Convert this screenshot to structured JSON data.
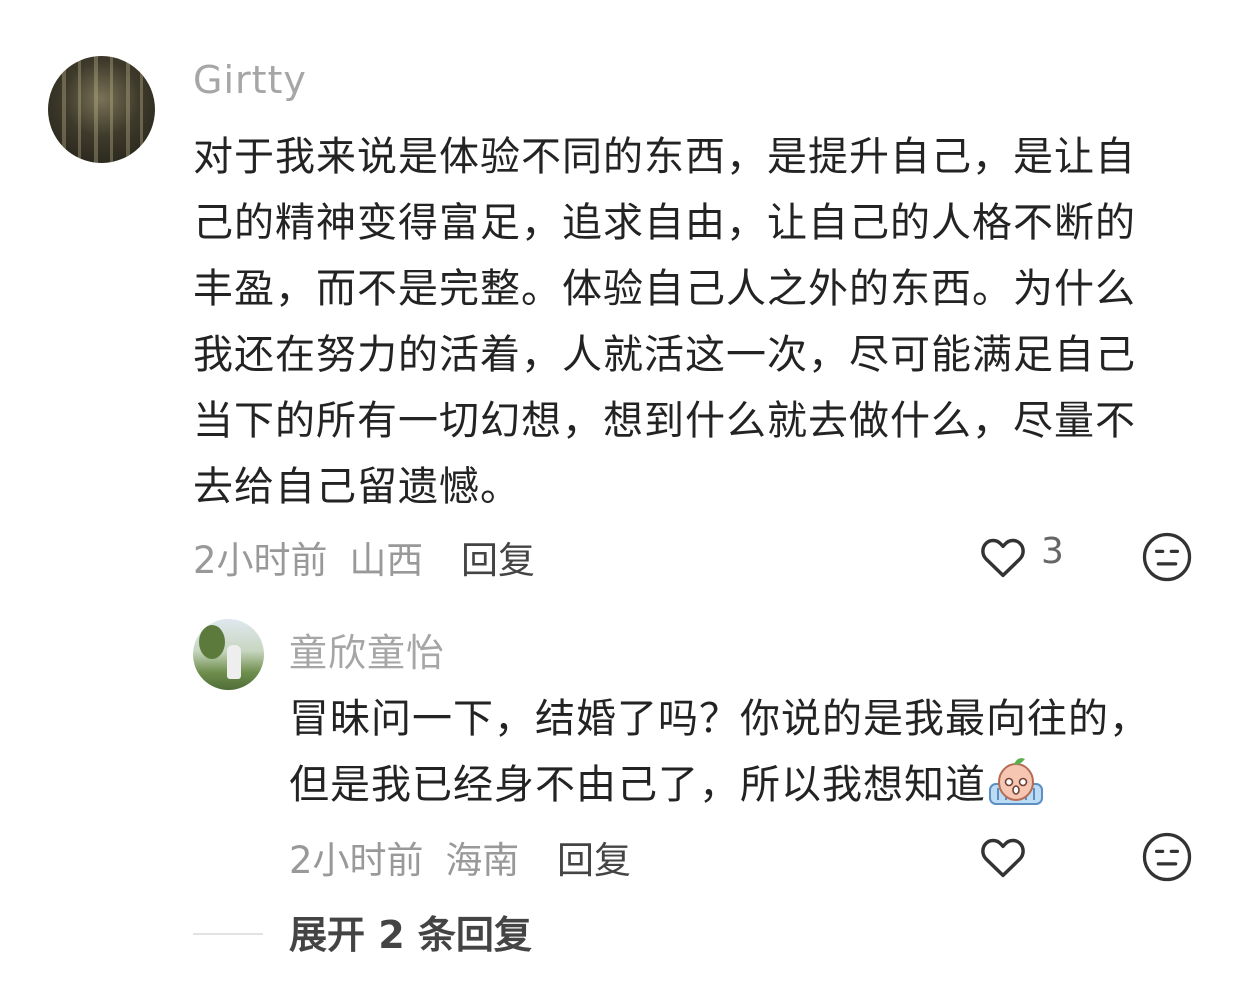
{
  "main_comment": {
    "username": "Girtty",
    "lines": [
      "对于我来说是体验不同的东西，是提升自己，是让自",
      "己的精神变得富足，追求自由，让自己的人格不断的",
      "丰盈，而不是完整。体验自己人之外的东西。为什么",
      "我还在努力的活着，人就活这一次，尽可能满足自己",
      "当下的所有一切幻想，想到什么就去做什么，尽量不",
      "去给自己留遗憾。"
    ],
    "time": "2小时前",
    "location": "山西",
    "reply_label": "回复",
    "like_count": "3",
    "like_icon": "heart-outline-icon",
    "dislike_icon": "meh-face-icon"
  },
  "reply_comment": {
    "username": "童欣童怡",
    "lines": [
      "冒昧问一下，结婚了吗？你说的是我最向往的，",
      "但是我已经身不由己了，所以我想知道"
    ],
    "emoji": "crying-peach-emoji",
    "time": "2小时前",
    "location": "海南",
    "reply_label": "回复",
    "like_icon": "heart-outline-icon",
    "dislike_icon": "meh-face-icon"
  },
  "expand_replies": "展开 2 条回复"
}
